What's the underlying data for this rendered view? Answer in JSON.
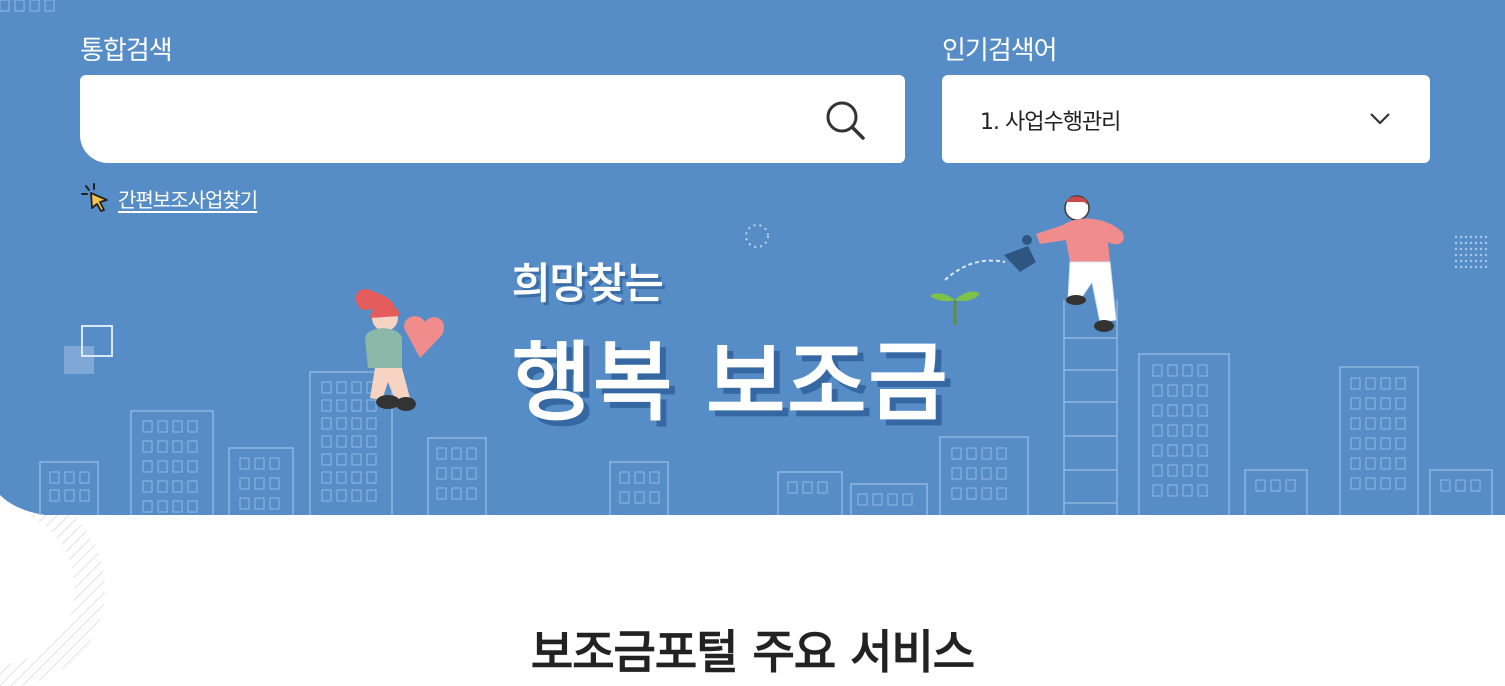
{
  "search": {
    "label": "통합검색",
    "value": "",
    "placeholder": ""
  },
  "popular": {
    "label": "인기검색어",
    "selected": "1. 사업수행관리"
  },
  "quick_link": {
    "label": "간편보조사업찾기"
  },
  "banner": {
    "subtitle": "희망찾는",
    "title": "행복 보조금"
  },
  "section": {
    "title_light": "보조금포털",
    "title_bold": "주요 서비스"
  },
  "colors": {
    "hero_bg": "#578dc7",
    "building_line": "#8fb6e0",
    "text_dark": "#222222"
  },
  "icons": {
    "search": "search-icon",
    "chevron": "chevron-down-icon",
    "quick_link": "pointer-click-icon"
  }
}
